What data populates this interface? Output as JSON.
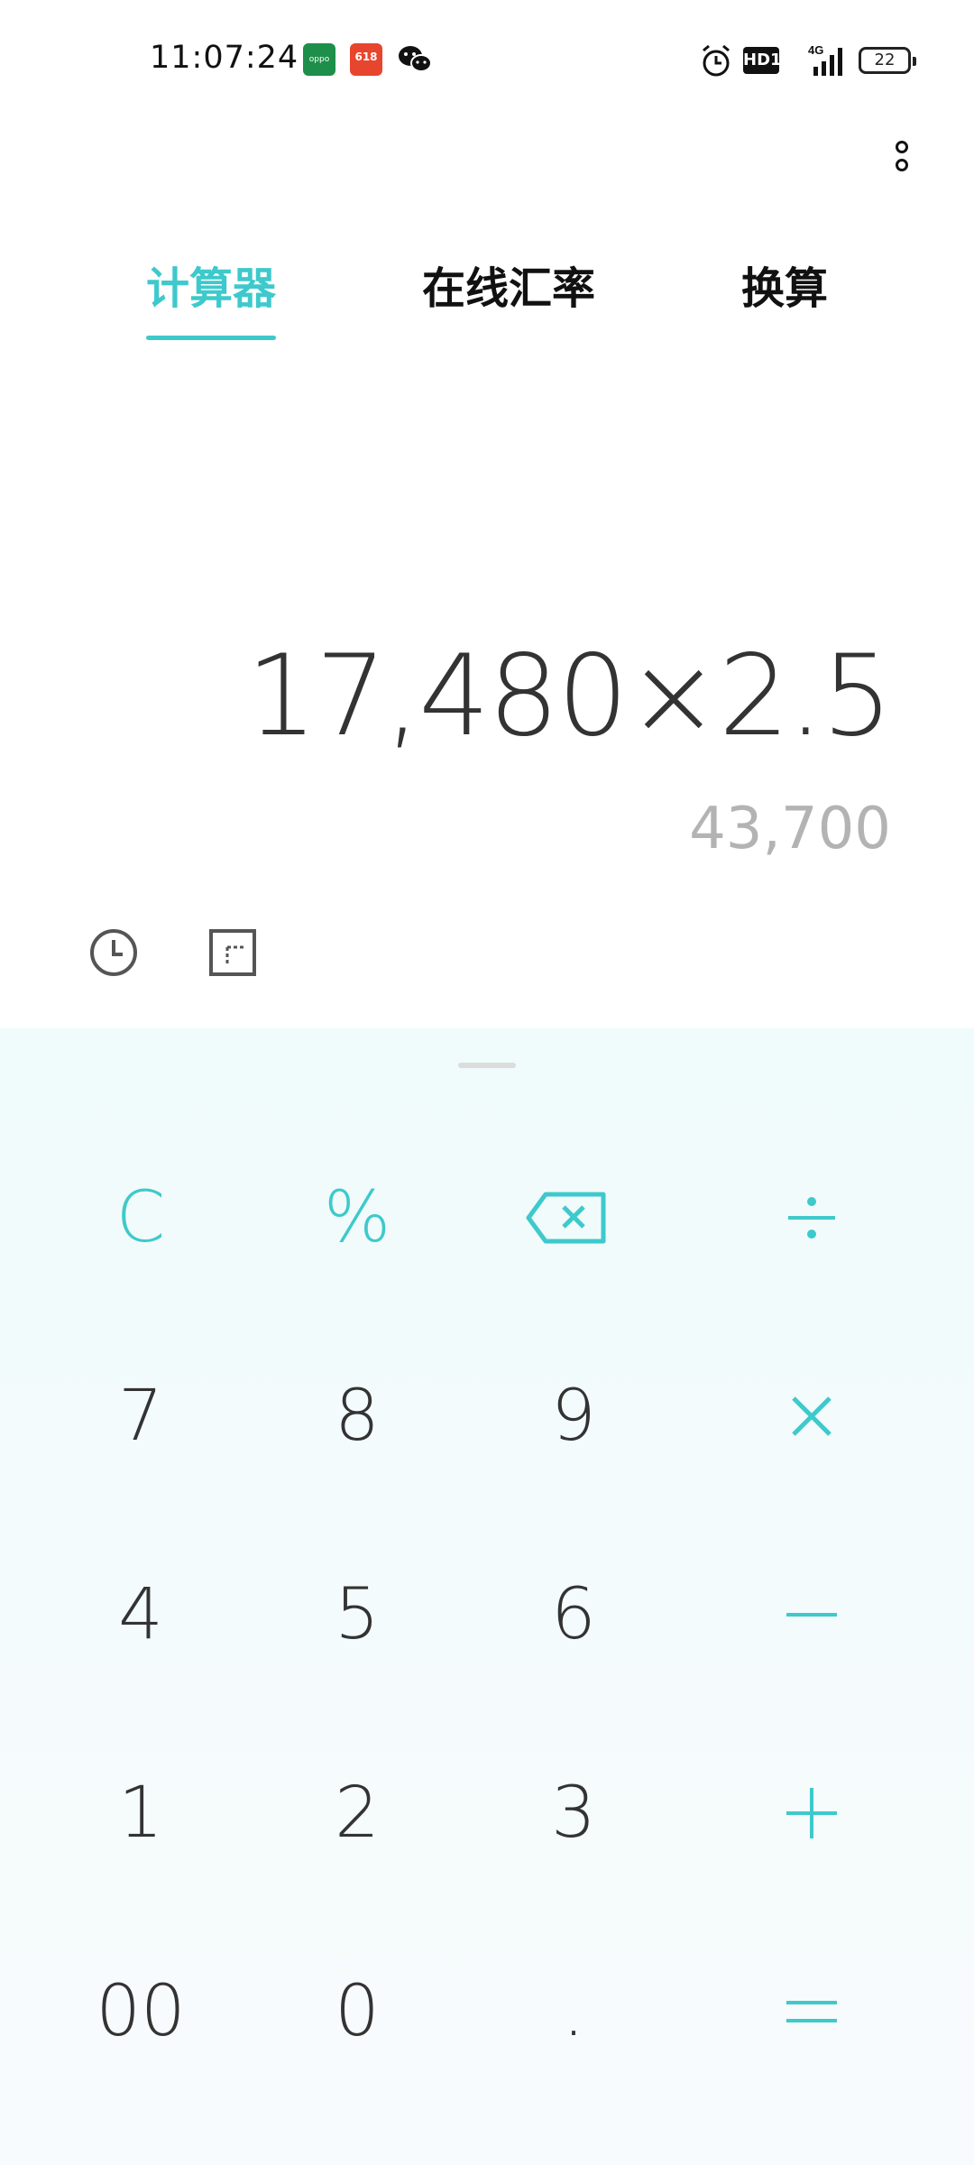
{
  "status_bar": {
    "time": "11:07:24",
    "sale_badge": "618",
    "hd_label": "HD1",
    "network": "4G",
    "battery": "22"
  },
  "tabs": [
    {
      "label": "计算器"
    },
    {
      "label": "在线汇率"
    },
    {
      "label": "换算"
    }
  ],
  "display": {
    "expression": "17,480×2.5",
    "result": "43,700"
  },
  "keypad": {
    "clear": "C",
    "percent": "%",
    "seven": "7",
    "eight": "8",
    "nine": "9",
    "four": "4",
    "five": "5",
    "six": "6",
    "one": "1",
    "two": "2",
    "three": "3",
    "double_zero": "00",
    "zero": "0",
    "decimal": "."
  },
  "colors": {
    "accent": "#3ec9cc",
    "text": "#333333",
    "result_text": "#b3b3b3",
    "keypad_bg": "#f0fbfb"
  }
}
